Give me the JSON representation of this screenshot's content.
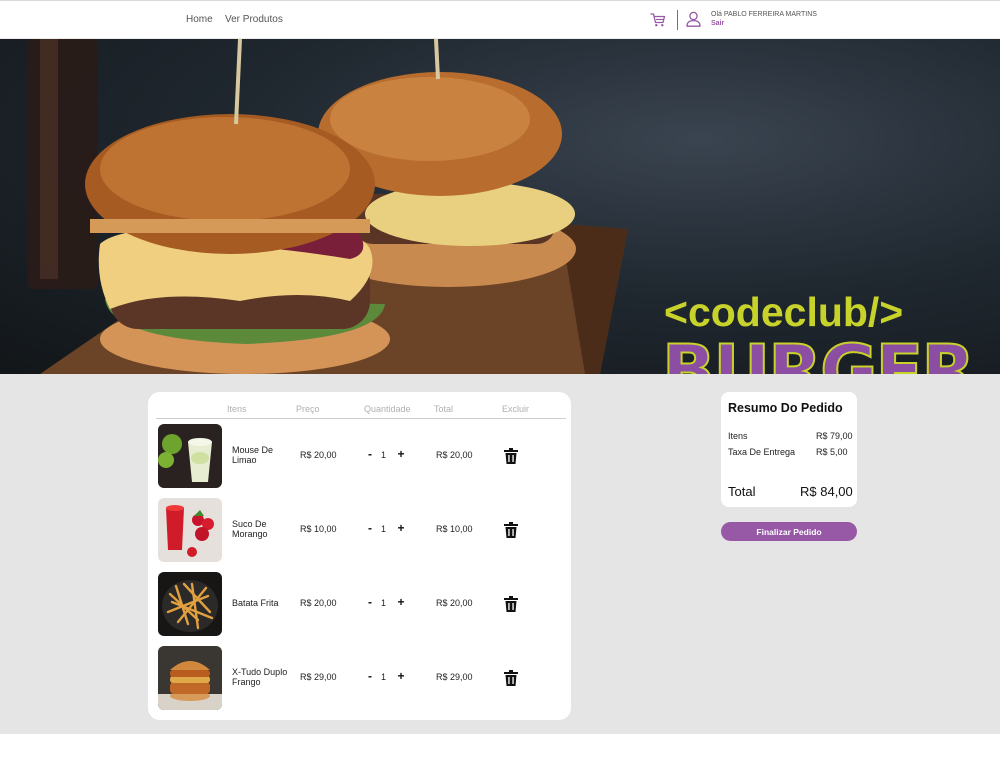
{
  "nav": {
    "home": "Home",
    "products": "Ver Produtos"
  },
  "user": {
    "greeting": "Olá PABLO FERREIRA MARTINS",
    "logout": "Sair"
  },
  "brand": {
    "code": "<codeclub/>",
    "burger": "BURGER"
  },
  "cart": {
    "headers": {
      "items": "Itens",
      "price": "Preço",
      "quantity": "Quantidade",
      "total": "Total",
      "delete": "Excluir"
    },
    "items": [
      {
        "name": "Mouse De Limao",
        "price": "R$ 20,00",
        "quantity": "1",
        "total": "R$ 20,00",
        "image": "lime-mousse"
      },
      {
        "name": "Suco De Morango",
        "price": "R$ 10,00",
        "quantity": "1",
        "total": "R$ 10,00",
        "image": "strawberry-juice"
      },
      {
        "name": "Batata Frita",
        "price": "R$ 20,00",
        "quantity": "1",
        "total": "R$ 20,00",
        "image": "french-fries"
      },
      {
        "name": "X-Tudo Duplo Frango",
        "price": "R$ 29,00",
        "quantity": "1",
        "total": "R$ 29,00",
        "image": "chicken-burger"
      }
    ],
    "minus": "-",
    "plus": "+"
  },
  "summary": {
    "title": "Resumo Do Pedido",
    "items_label": "Itens",
    "items_value": "R$ 79,00",
    "delivery_label": "Taxa De Entrega",
    "delivery_value": "R$ 5,00",
    "total_label": "Total",
    "total_value": "R$ 84,00"
  },
  "checkout_label": "Finalizar Pedido",
  "colors": {
    "accent": "#9758a6",
    "brand_green": "#c7d22b",
    "background": "#e5e5e5"
  }
}
